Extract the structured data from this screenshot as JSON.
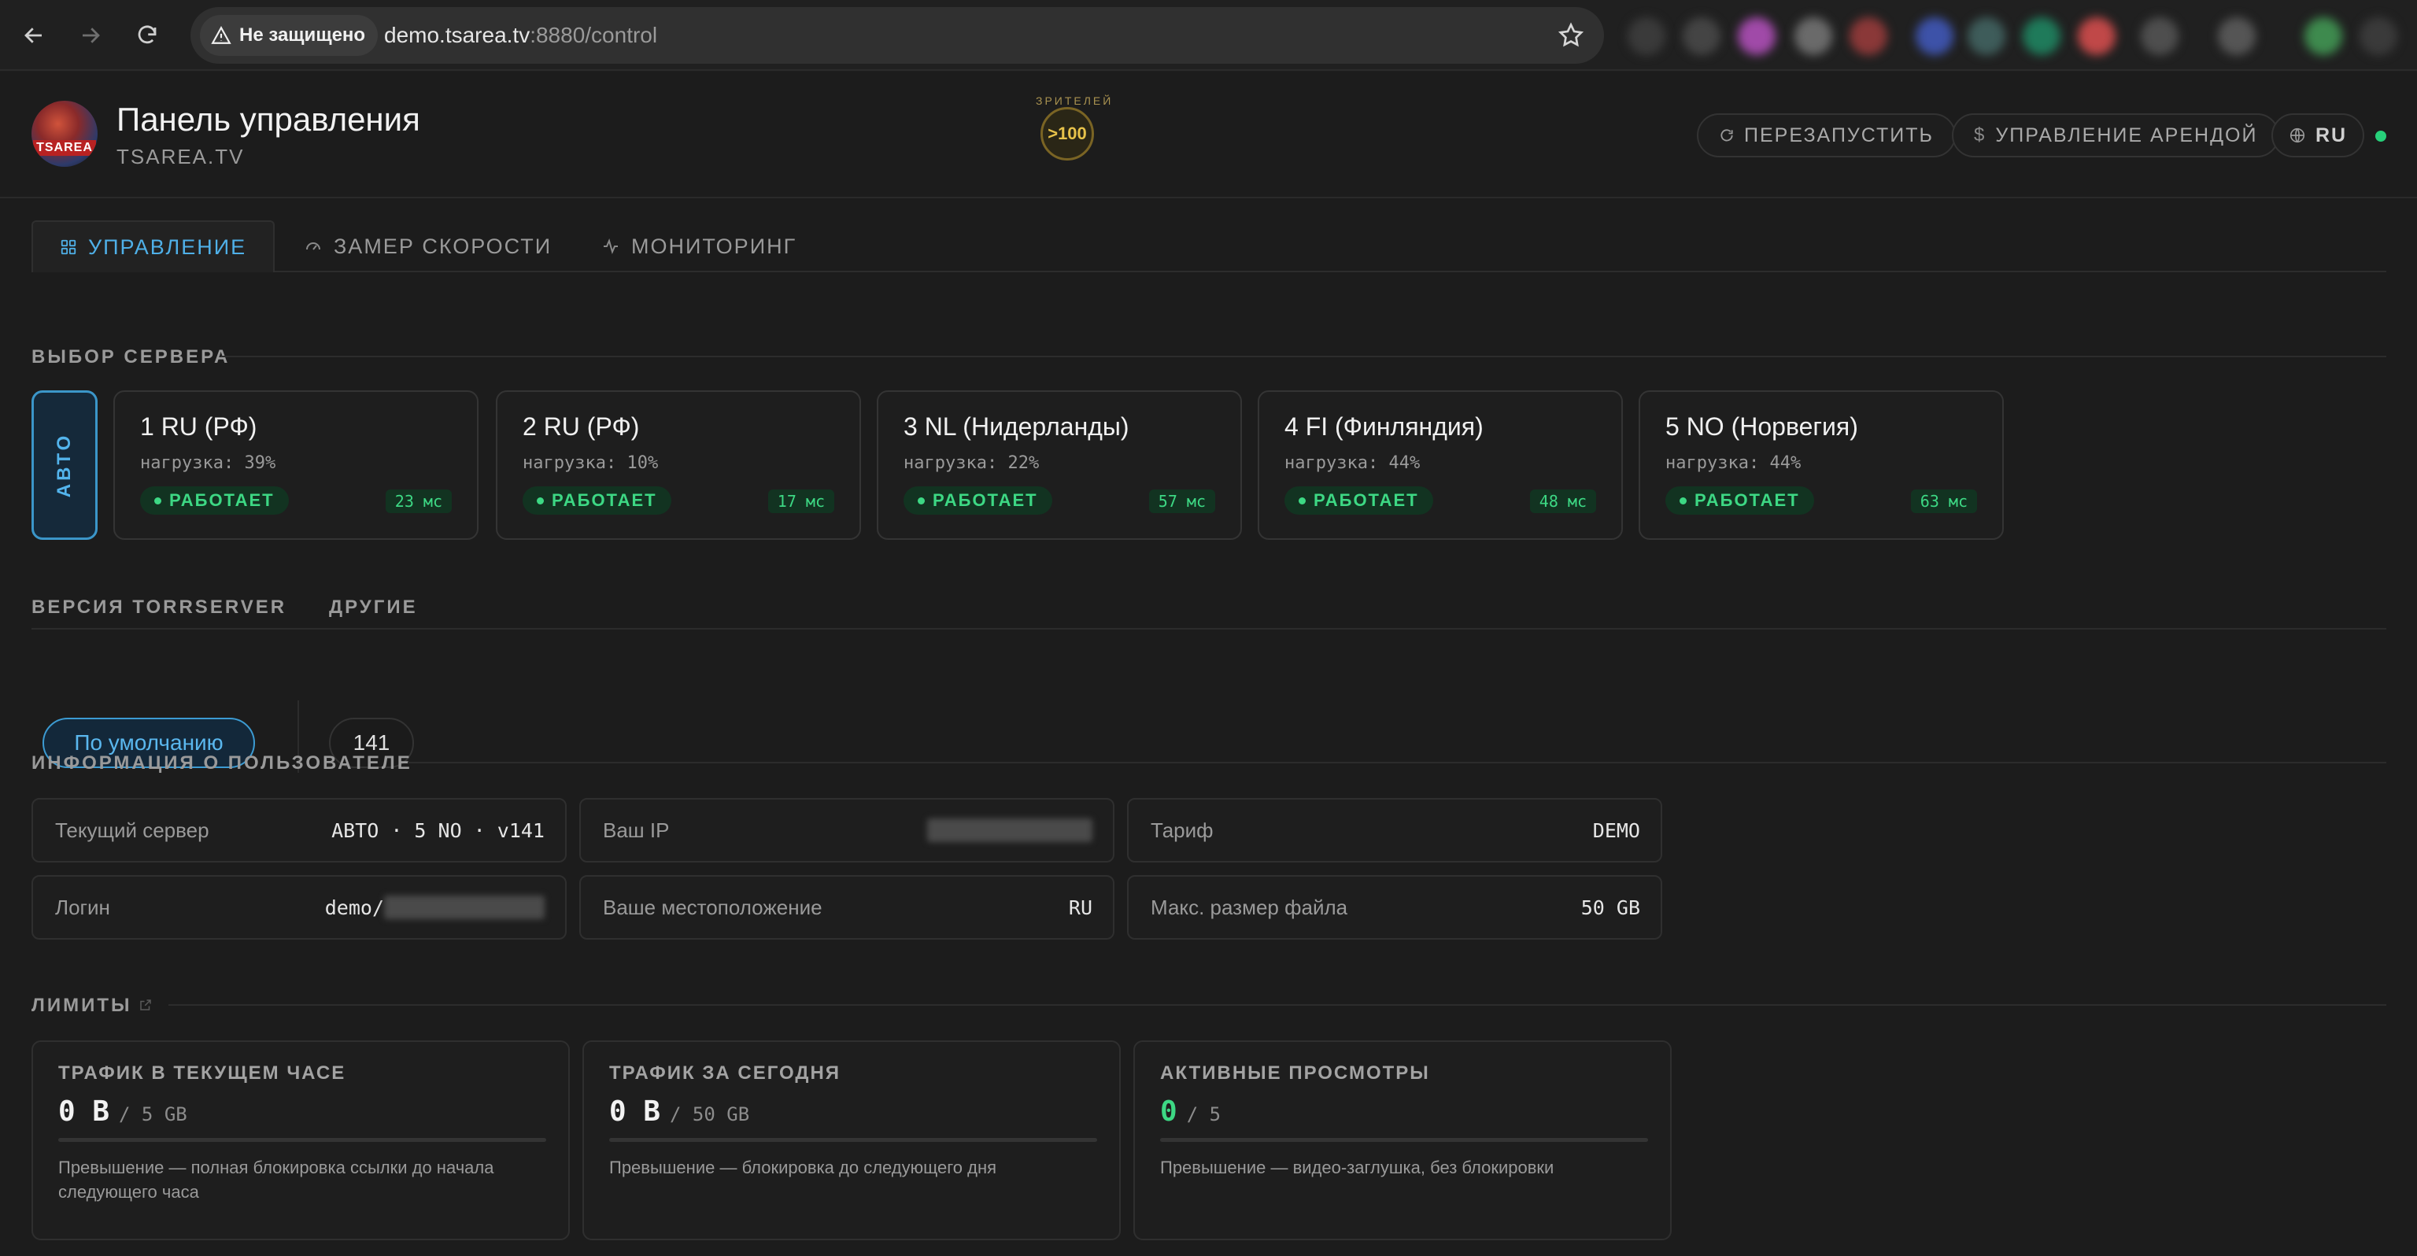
{
  "browser": {
    "security_label": "Не защищено",
    "url_host": "demo.tsarea.tv",
    "url_rest": ":8880/control"
  },
  "header": {
    "title": "Панель управления",
    "subtitle": "TSAREA.TV",
    "logo_text": "TSAREA",
    "viewers_arc": "ЗРИТЕЛЕЙ",
    "viewers_value": ">100",
    "restart_label": "ПЕРЕЗАПУСТИТЬ",
    "rent_label": "УПРАВЛЕНИЕ АРЕНДОЙ",
    "lang_label": "RU",
    "status_color": "#27d07a"
  },
  "tabs": [
    {
      "label": "УПРАВЛЕНИЕ",
      "icon": "grid-icon",
      "active": true
    },
    {
      "label": "ЗАМЕР СКОРОСТИ",
      "icon": "speedometer-icon",
      "active": false
    },
    {
      "label": "МОНИТОРИНГ",
      "icon": "activity-icon",
      "active": false
    }
  ],
  "server_section": {
    "label": "ВЫБОР СЕРВЕРА",
    "auto_label": "АВТО",
    "servers": [
      {
        "name": "1 RU (РФ)",
        "load": "нагрузка: 39%",
        "status": "РАБОТАЕТ",
        "ping": "23 мс"
      },
      {
        "name": "2 RU (РФ)",
        "load": "нагрузка: 10%",
        "status": "РАБОТАЕТ",
        "ping": "17 мс"
      },
      {
        "name": "3 NL (Нидерланды)",
        "load": "нагрузка: 22%",
        "status": "РАБОТАЕТ",
        "ping": "57 мс"
      },
      {
        "name": "4 FI (Финляндия)",
        "load": "нагрузка: 44%",
        "status": "РАБОТАЕТ",
        "ping": "48 мс"
      },
      {
        "name": "5 NO (Норвегия)",
        "load": "нагрузка: 44%",
        "status": "РАБОТАЕТ",
        "ping": "63 мс"
      }
    ]
  },
  "version_section": {
    "label": "ВЕРСИЯ TORRSERVER",
    "default_label": "По умолчанию",
    "other_label": "ДРУГИЕ",
    "other_value": "141"
  },
  "user_section": {
    "label": "ИНФОРМАЦИЯ О ПОЛЬЗОВАТЕЛЕ",
    "current_server_key": "Текущий сервер",
    "current_server_val": "АВТО · 5 NO · v141",
    "ip_key": "Ваш IP",
    "tariff_key": "Тариф",
    "tariff_val": "DEMO",
    "login_key": "Логин",
    "login_val": "demo/",
    "location_key": "Ваше местоположение",
    "location_val": "RU",
    "maxsize_key": "Макс. размер файла",
    "maxsize_val": "50 GB"
  },
  "limits_section": {
    "label": "ЛИМИТЫ",
    "cards": [
      {
        "title": "ТРАФИК В ТЕКУЩЕМ ЧАСЕ",
        "value": "0 B",
        "limit": "/ 5 GB",
        "progress": 0,
        "desc": "Превышение — полная блокировка ссылки до начала следующего часа"
      },
      {
        "title": "ТРАФИК ЗА СЕГОДНЯ",
        "value": "0 B",
        "limit": "/ 50 GB",
        "progress": 0,
        "desc": "Превышение — блокировка до следующего дня"
      },
      {
        "title": "АКТИВНЫЕ ПРОСМОТРЫ",
        "value": "0",
        "limit": "/ 5",
        "progress": 0,
        "desc": "Превышение — видео-заглушка, без блокировки",
        "value_color": "#3dd884"
      }
    ]
  }
}
